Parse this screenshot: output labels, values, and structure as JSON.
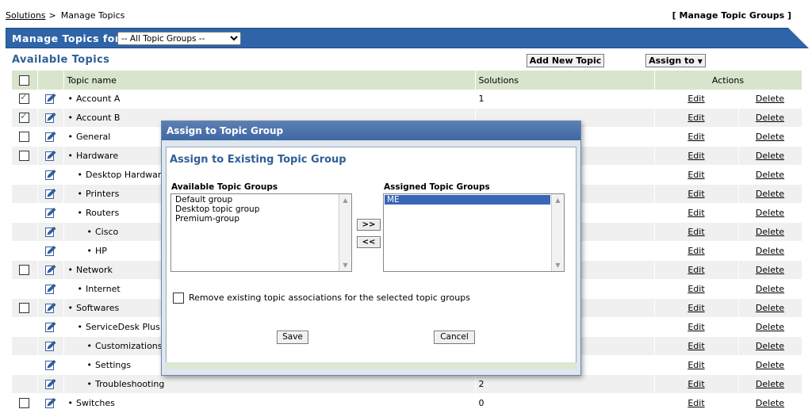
{
  "breadcrumb": {
    "root": "Solutions",
    "separator": ">",
    "current": "Manage Topics"
  },
  "manage_topic_groups_link": "[ Manage Topic Groups ]",
  "header": {
    "title": "Manage Topics  for",
    "filter_value": "-- All Topic Groups --"
  },
  "section_title": "Available Topics",
  "add_new_topic_label": "Add New Topic",
  "assign_to_label": "Assign to",
  "table": {
    "columns": [
      "Topic name",
      "Solutions",
      "Actions"
    ],
    "edit_label": "Edit",
    "delete_label": "Delete",
    "rows": [
      {
        "name": "Account A",
        "level": 0,
        "checkbox": true,
        "checked": true,
        "solutions": "1"
      },
      {
        "name": "Account B",
        "level": 0,
        "checkbox": true,
        "checked": true,
        "solutions": ""
      },
      {
        "name": "General",
        "level": 0,
        "checkbox": true,
        "checked": false,
        "solutions": ""
      },
      {
        "name": "Hardware",
        "level": 0,
        "checkbox": true,
        "checked": false,
        "solutions": ""
      },
      {
        "name": "Desktop Hardware",
        "level": 1,
        "checkbox": false,
        "checked": false,
        "solutions": ""
      },
      {
        "name": "Printers",
        "level": 1,
        "checkbox": false,
        "checked": false,
        "solutions": ""
      },
      {
        "name": "Routers",
        "level": 1,
        "checkbox": false,
        "checked": false,
        "solutions": ""
      },
      {
        "name": "Cisco",
        "level": 2,
        "checkbox": false,
        "checked": false,
        "solutions": ""
      },
      {
        "name": "HP",
        "level": 2,
        "checkbox": false,
        "checked": false,
        "solutions": ""
      },
      {
        "name": "Network",
        "level": 0,
        "checkbox": true,
        "checked": false,
        "solutions": ""
      },
      {
        "name": "Internet",
        "level": 1,
        "checkbox": false,
        "checked": false,
        "solutions": ""
      },
      {
        "name": "Softwares",
        "level": 0,
        "checkbox": true,
        "checked": false,
        "solutions": ""
      },
      {
        "name": "ServiceDesk Plus",
        "level": 1,
        "checkbox": false,
        "checked": false,
        "solutions": ""
      },
      {
        "name": "Customizations",
        "level": 2,
        "checkbox": false,
        "checked": false,
        "solutions": ""
      },
      {
        "name": "Settings",
        "level": 2,
        "checkbox": false,
        "checked": false,
        "solutions": ""
      },
      {
        "name": "Troubleshooting",
        "level": 2,
        "checkbox": false,
        "checked": false,
        "solutions": "2"
      },
      {
        "name": "Switches",
        "level": 0,
        "checkbox": true,
        "checked": false,
        "solutions": "0"
      }
    ]
  },
  "modal": {
    "title": "Assign to Topic Group",
    "subtitle": "Assign to Existing Topic Group",
    "available_label": "Available Topic Groups",
    "assigned_label": "Assigned Topic Groups",
    "available_items": [
      "Default group",
      "Desktop topic group",
      "Premium-group"
    ],
    "assigned_items": [
      "ME"
    ],
    "move_right_label": ">>",
    "move_left_label": "<<",
    "remove_label": "Remove existing topic associations for the selected topic groups",
    "save_label": "Save",
    "cancel_label": "Cancel"
  },
  "colors": {
    "header_blue": "#2f64a8",
    "table_header": "#d9e4cd",
    "accent_text": "#2f5f97"
  }
}
